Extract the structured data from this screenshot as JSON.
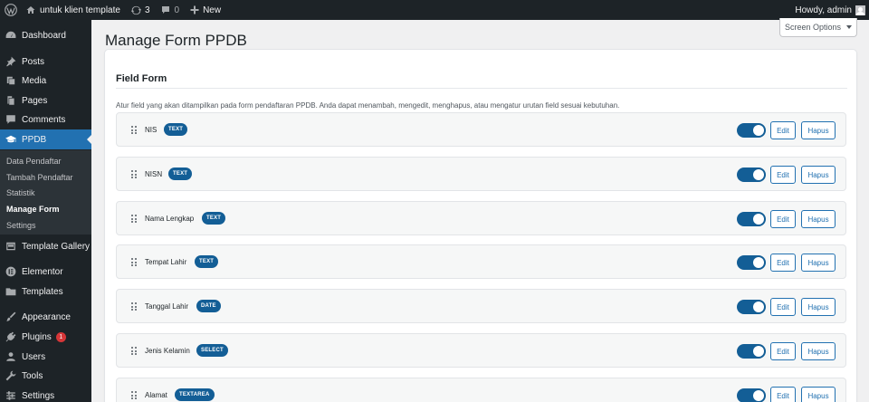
{
  "adminbar": {
    "wp_icon": "wordpress-logo-icon",
    "site_name": "untuk klien template",
    "updates_count": "3",
    "comments_count": "0",
    "new_label": "New",
    "howdy": "Howdy, admin"
  },
  "sidebar": {
    "items": {
      "dashboard": "Dashboard",
      "posts": "Posts",
      "media": "Media",
      "pages": "Pages",
      "comments": "Comments",
      "ppdb": "PPDB",
      "template_gallery": "Template Gallery",
      "elementor": "Elementor",
      "templates": "Templates",
      "appearance": "Appearance",
      "plugins": "Plugins",
      "plugins_badge": "1",
      "users": "Users",
      "tools": "Tools",
      "settings": "Settings"
    },
    "submenu": {
      "data_pendaftar": "Data Pendaftar",
      "tambah_pendaftar": "Tambah Pendaftar",
      "statistik": "Statistik",
      "manage_form": "Manage Form",
      "settings": "Settings"
    }
  },
  "page": {
    "title": "Manage Form PPDB",
    "screen_options": "Screen Options"
  },
  "card": {
    "title": "Field Form",
    "description": "Atur field yang akan ditampilkan pada form pendaftaran PPDB. Anda dapat menambah, mengedit, menghapus, atau mengatur urutan field sesuai kebutuhan.",
    "edit_label": "Edit",
    "delete_label": "Hapus",
    "fields": [
      {
        "label": "NIS",
        "type": "TEXT"
      },
      {
        "label": "NISN",
        "type": "TEXT"
      },
      {
        "label": "Nama Lengkap",
        "type": "TEXT"
      },
      {
        "label": "Tempat Lahir",
        "type": "TEXT"
      },
      {
        "label": "Tanggal Lahir",
        "type": "DATE"
      },
      {
        "label": "Jenis Kelamin",
        "type": "SELECT"
      },
      {
        "label": "Alamat",
        "type": "TEXTAREA"
      }
    ]
  },
  "colors": {
    "adminbar_bg": "#1d2327",
    "accent": "#2271b1",
    "badge": "#135e96",
    "notice": "#d63638"
  }
}
